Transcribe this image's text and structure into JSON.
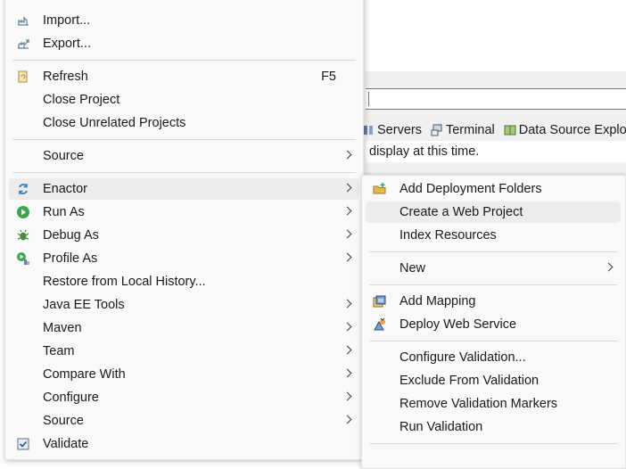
{
  "background": {
    "tabs": [
      {
        "label": "Servers",
        "icon": "servers-icon"
      },
      {
        "label": "Terminal",
        "icon": "terminal-icon"
      },
      {
        "label": "Data Source Explo",
        "icon": "data-source-explorer-icon"
      }
    ],
    "message": "display at this time."
  },
  "context_menu": {
    "items": [
      {
        "label": "Import...",
        "icon": "import-icon"
      },
      {
        "label": "Export...",
        "icon": "export-icon"
      },
      {
        "label": "Refresh",
        "icon": "refresh-icon",
        "accelerator": "F5"
      },
      {
        "label": "Close Project"
      },
      {
        "label": "Close Unrelated Projects"
      },
      {
        "label": "Source",
        "submenu": true
      },
      {
        "label": "Enactor",
        "icon": "enactor-icon",
        "submenu": true,
        "highlighted": true
      },
      {
        "label": "Run As",
        "icon": "run-icon",
        "submenu": true
      },
      {
        "label": "Debug As",
        "icon": "debug-bug-icon",
        "submenu": true
      },
      {
        "label": "Profile As",
        "icon": "profile-icon",
        "submenu": true
      },
      {
        "label": "Restore from Local History..."
      },
      {
        "label": "Java EE Tools",
        "submenu": true
      },
      {
        "label": "Maven",
        "submenu": true
      },
      {
        "label": "Team",
        "submenu": true
      },
      {
        "label": "Compare With",
        "submenu": true
      },
      {
        "label": "Configure",
        "submenu": true
      },
      {
        "label": "Source",
        "submenu": true
      },
      {
        "label": "Validate",
        "icon": "checkbox-checked-icon"
      }
    ]
  },
  "submenu": {
    "items": [
      {
        "label": "Add Deployment Folders",
        "icon": "add-folder-icon"
      },
      {
        "label": "Create a Web Project",
        "highlighted": true
      },
      {
        "label": "Index Resources"
      },
      {
        "label": "New",
        "submenu": true
      },
      {
        "label": "Add Mapping",
        "icon": "add-mapping-icon"
      },
      {
        "label": "Deploy Web Service",
        "icon": "deploy-web-service-icon"
      },
      {
        "label": "Configure Validation..."
      },
      {
        "label": "Exclude From Validation"
      },
      {
        "label": "Remove Validation Markers"
      },
      {
        "label": "Run Validation"
      }
    ]
  }
}
